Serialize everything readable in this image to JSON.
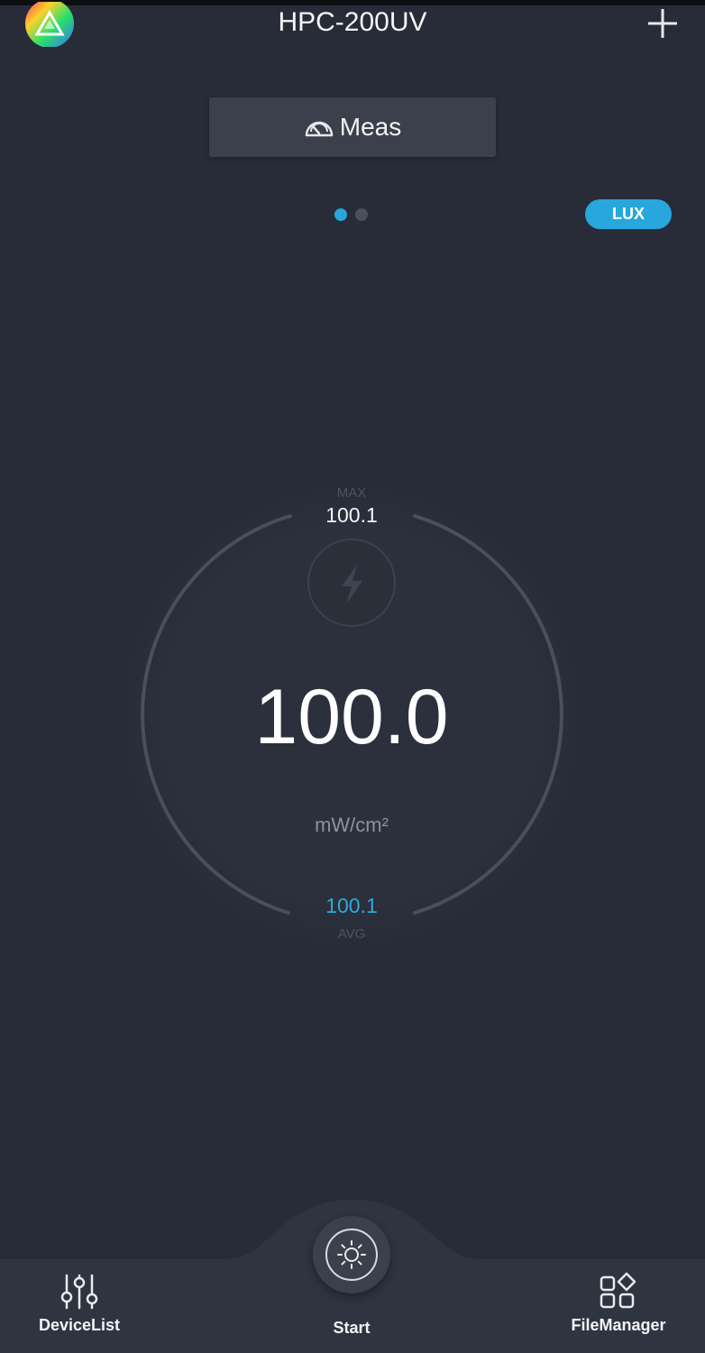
{
  "header": {
    "title": "HPC-200UV",
    "logo_icon": "rainbow-triangle-logo-icon",
    "add_icon": "plus-icon"
  },
  "mode_tab": {
    "label": "Meas",
    "icon": "speedometer-icon"
  },
  "pager": {
    "pages": 2,
    "active_index": 0
  },
  "unit_toggle": {
    "label": "LUX"
  },
  "gauge": {
    "max_label": "MAX",
    "max_value": "100.1",
    "reading": "100.0",
    "unit": "mW/cm²",
    "avg_value": "100.1",
    "avg_label": "AVG",
    "center_icon": "lightning-bolt-icon"
  },
  "bottom_nav": {
    "device_list": {
      "label": "DeviceList",
      "icon": "sliders-icon"
    },
    "start": {
      "label": "Start",
      "icon": "sun-icon"
    },
    "file_manager": {
      "label": "FileManager",
      "icon": "grid-shapes-icon"
    }
  },
  "colors": {
    "background": "#272c38",
    "accent": "#27a7dd",
    "panel": "#3b404c",
    "nav_bar": "#2f3441"
  }
}
